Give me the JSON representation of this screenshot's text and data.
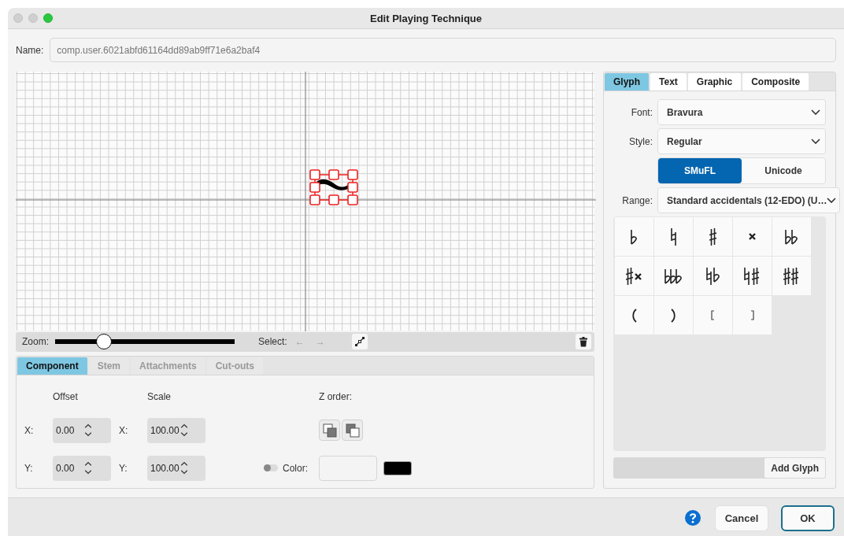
{
  "window": {
    "title": "Edit Playing Technique"
  },
  "name_field": {
    "label": "Name:",
    "value": "comp.user.6021abfd61164dd89ab9ff71e6a2baf4",
    "disabled": true
  },
  "toolbar": {
    "zoom_label": "Zoom:",
    "zoom": {
      "level": 0.27
    },
    "select_label": "Select:",
    "select_prev": {
      "label": "←",
      "disabled": true
    },
    "select_next": {
      "label": "→",
      "disabled": true
    }
  },
  "component_tabs": [
    {
      "label": "Component",
      "selected": true,
      "disabled": false
    },
    {
      "label": "Stem",
      "selected": false,
      "disabled": true
    },
    {
      "label": "Attachments",
      "selected": false,
      "disabled": true
    },
    {
      "label": "Cut-outs",
      "selected": false,
      "disabled": true
    }
  ],
  "component": {
    "offset_label": "Offset",
    "scale_label": "Scale",
    "z_order_label": "Z order:",
    "offset_x": {
      "label": "X:",
      "value": "0.00"
    },
    "offset_y": {
      "label": "Y:",
      "value": "0.00"
    },
    "scale_x": {
      "label": "X:",
      "value": "100.00"
    },
    "scale_y": {
      "label": "Y:",
      "value": "100.00"
    },
    "color_toggle": {
      "on": false
    },
    "color_label": "Color:"
  },
  "glyph_tabs": [
    {
      "label": "Glyph",
      "selected": true
    },
    {
      "label": "Text",
      "selected": false
    },
    {
      "label": "Graphic",
      "selected": false
    },
    {
      "label": "Composite",
      "selected": false
    }
  ],
  "glyph_panel": {
    "font": {
      "label": "Font:",
      "value": "Bravura"
    },
    "style": {
      "label": "Style:",
      "value": "Regular"
    },
    "modes": [
      {
        "label": "SMuFL",
        "selected": true
      },
      {
        "label": "Unicode",
        "selected": false
      }
    ],
    "range": {
      "label": "Range:",
      "value": "Standard accidentals (12-EDO) (U…"
    },
    "glyphs": [
      {
        "kind": "flat"
      },
      {
        "kind": "natural"
      },
      {
        "kind": "sharp"
      },
      {
        "kind": "double-sharp"
      },
      {
        "kind": "double-flat"
      },
      {
        "kind": "sharp-double-sharp"
      },
      {
        "kind": "triple-flat"
      },
      {
        "kind": "natural-flat"
      },
      {
        "kind": "natural-sharp"
      },
      {
        "kind": "sharp-sharp"
      },
      {
        "kind": "paren-left"
      },
      {
        "kind": "paren-right"
      },
      {
        "kind": "bracket-left"
      },
      {
        "kind": "bracket-right"
      }
    ],
    "add_button": "Add Glyph"
  },
  "footer": {
    "cancel": "Cancel",
    "ok": "OK"
  }
}
